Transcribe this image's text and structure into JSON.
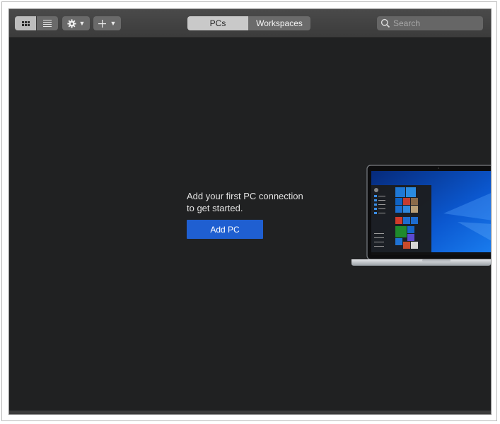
{
  "toolbar": {
    "view_grid_icon": "grid-icon",
    "view_list_icon": "list-icon",
    "settings_icon": "gear-icon",
    "add_icon": "plus-icon",
    "dropdown_icon": "chevron-down-icon"
  },
  "tabs": [
    {
      "label": "PCs",
      "active": true
    },
    {
      "label": "Workspaces",
      "active": false
    }
  ],
  "search": {
    "placeholder": "Search",
    "value": ""
  },
  "empty_state": {
    "line1": "Add your first PC connection",
    "line2": "to get started.",
    "button_label": "Add PC"
  },
  "colors": {
    "window_bg": "#202122",
    "toolbar_bg": "#3f3f3f",
    "accent": "#1f5fd1",
    "desktop_blue": "#0a4fc1"
  }
}
